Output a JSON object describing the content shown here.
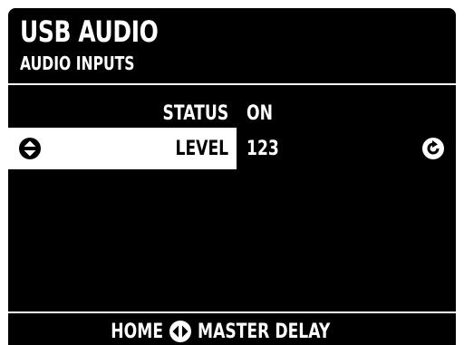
{
  "header": {
    "title": "USB AUDIO",
    "subtitle": "AUDIO INPUTS"
  },
  "params": [
    {
      "label": "STATUS",
      "value": "ON"
    },
    {
      "label": "LEVEL",
      "value": "123"
    }
  ],
  "selected_param": "LEVEL",
  "icons": {
    "selector": "up-down-arrows-icon",
    "action": "refresh-icon",
    "footer_nav": "left-right-arrows-icon"
  },
  "footer": {
    "prev_label": "HOME",
    "next_label": "MASTER DELAY"
  },
  "colors": {
    "screen_background": "#000000",
    "foreground": "#ffffff",
    "selection_background": "#ffffff",
    "selection_text": "#000000"
  }
}
